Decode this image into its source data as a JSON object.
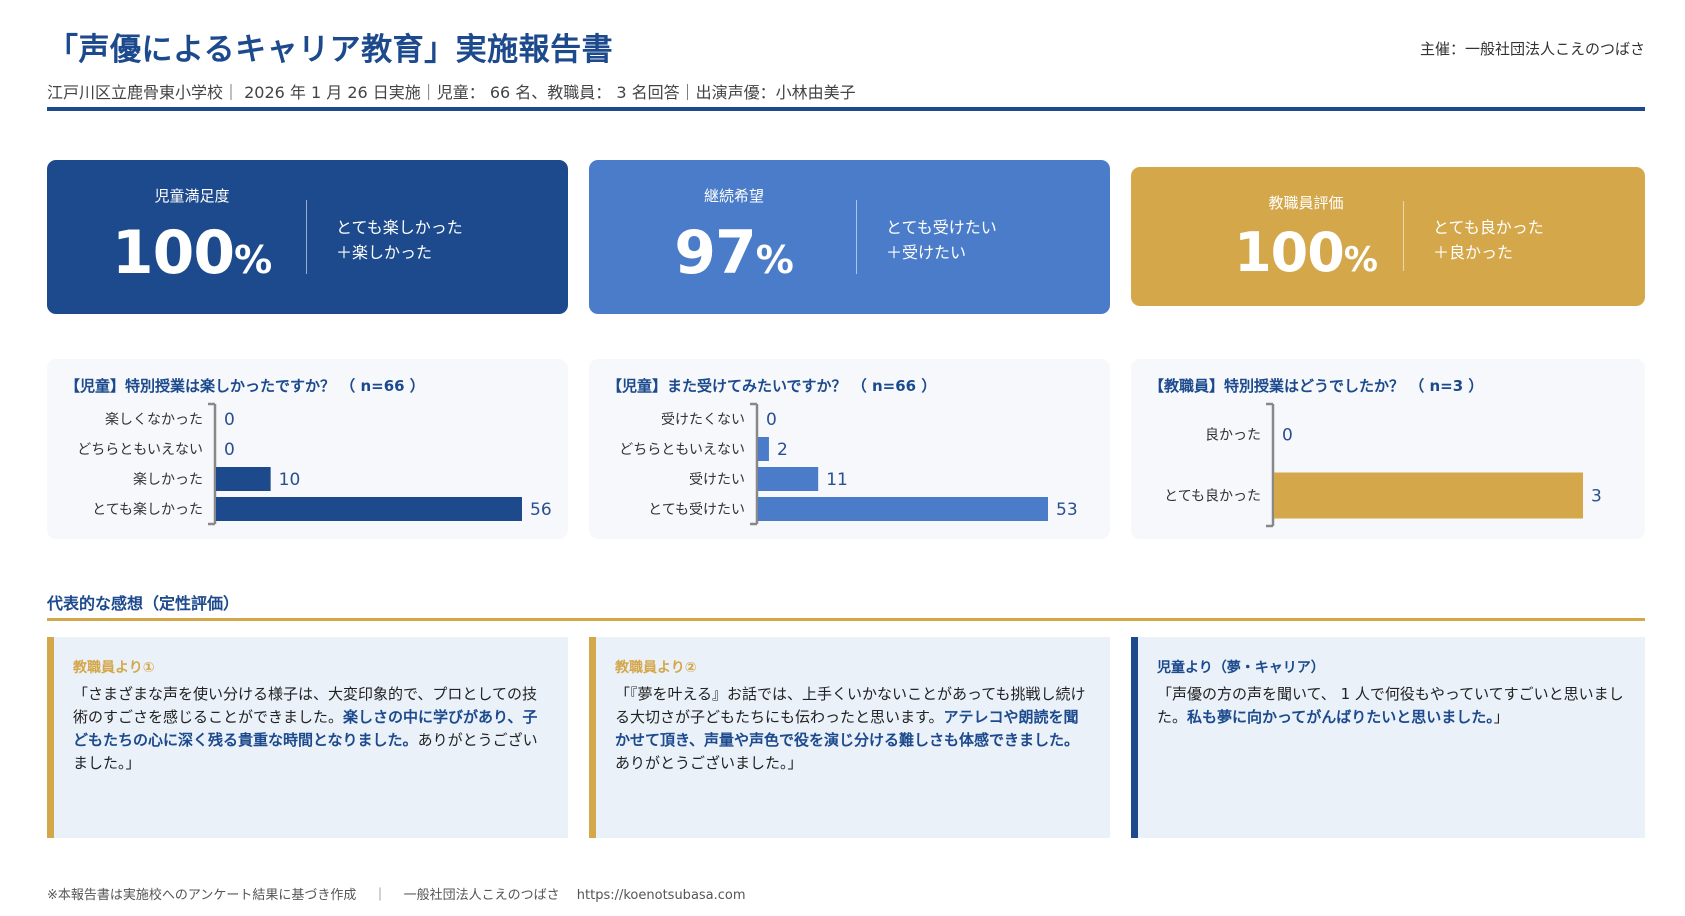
{
  "header": {
    "title": "「声優によるキャリア教育」実施報告書",
    "organizer": "主催：一般社団法人こえのつばさ",
    "subtitle": "江戸川区立鹿骨東小学校｜ 2026 年 1 月 26 日実施｜児童： 66 名、教職員： 3 名回答｜出演声優：小林由美子"
  },
  "kpis": [
    {
      "label": "児童満足度",
      "value": "100",
      "unit": "%",
      "desc_line1": "とても楽しかった",
      "desc_line2": "＋楽しかった",
      "color": "#1c4a8c"
    },
    {
      "label": "継続希望",
      "value": "97",
      "unit": "%",
      "desc_line1": "とても受けたい",
      "desc_line2": "＋受けたい",
      "color": "#4a7cc9"
    },
    {
      "label": "教職員評価",
      "value": "100",
      "unit": "%",
      "desc_line1": "とても良かった",
      "desc_line2": "＋良かった",
      "color": "#d4a74a"
    }
  ],
  "chart_data": [
    {
      "type": "bar",
      "orientation": "horizontal",
      "title": "【児童】特別授業は楽しかったですか？ （ n=66 ）",
      "categories": [
        "楽しくなかった",
        "どちらともいえない",
        "楽しかった",
        "とても楽しかった"
      ],
      "values": [
        0,
        0,
        10,
        56
      ],
      "xlim": [
        0,
        56
      ],
      "color": "#1c4a8c",
      "grid": false
    },
    {
      "type": "bar",
      "orientation": "horizontal",
      "title": "【児童】また受けてみたいですか？ （ n=66 ）",
      "categories": [
        "受けたくない",
        "どちらともいえない",
        "受けたい",
        "とても受けたい"
      ],
      "values": [
        0,
        2,
        11,
        53
      ],
      "xlim": [
        0,
        53
      ],
      "color": "#4a7cc9",
      "grid": false
    },
    {
      "type": "bar",
      "orientation": "horizontal",
      "title": "【教職員】特別授業はどうでしたか？ （ n=3 ）",
      "categories": [
        "良かった",
        "とても良かった"
      ],
      "values": [
        0,
        3
      ],
      "xlim": [
        0,
        3
      ],
      "color": "#d4a74a",
      "grid": false
    }
  ],
  "section": {
    "title": "代表的な感想（定性評価）"
  },
  "quotes": [
    {
      "head": "教職員より①",
      "accent": "#d4a74a",
      "text_plain": "「さまざまな声を使い分ける様子は、大変印象的で、プロとしての技術のすごさを感じることができました。",
      "text_highlight": "楽しさの中に学びがあり、子どもたちの心に深く残る貴重な時間となりました。",
      "text_end": "ありがとうございました。」"
    },
    {
      "head": "教職員より②",
      "accent": "#d4a74a",
      "text_plain": "「『夢を叶える』お話では、上手くいかないことがあっても挑戦し続ける大切さが子どもたちにも伝わったと思います。",
      "text_highlight": "アテレコや朗読を聞かせて頂き、声量や声色で役を演じ分ける難しさも体感できました。",
      "text_end": "ありがとうございました。」"
    },
    {
      "head": "児童より（夢・キャリア）",
      "accent": "#1c4a8c",
      "text_plain": "「声優の方の声を聞いて、 1 人で何役もやっていてすごいと思いました。",
      "text_highlight": "私も夢に向かってがんばりたいと思いました。",
      "text_end": "」"
    }
  ],
  "footer": {
    "text": "※本報告書は実施校へのアンケート結果に基づき作成　 ｜　 一般社団法人こえのつばさ　 https://koenotsubasa.com"
  }
}
